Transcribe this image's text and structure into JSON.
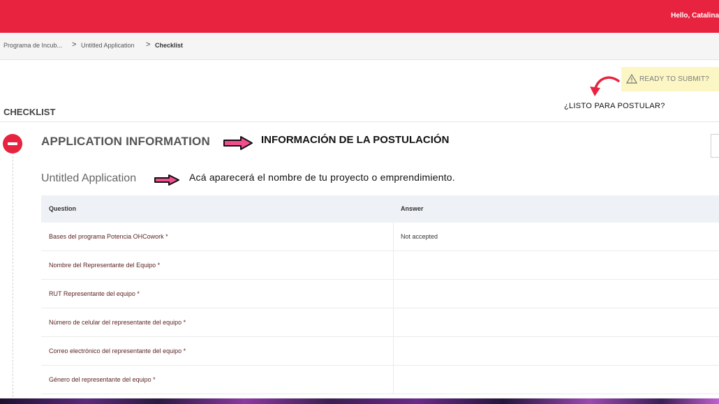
{
  "header": {
    "greeting": "Hello, Catalina"
  },
  "breadcrumb": {
    "items": [
      "Programa de Incub...",
      "Untitled Application",
      "Checklist"
    ],
    "separator": ">"
  },
  "status": {
    "ready_label": "READY TO SUBMIT?",
    "annotation": "¿LISTO PARA POSTULAR?"
  },
  "checklist": {
    "title": "CHECKLIST"
  },
  "section": {
    "title": "APPLICATION INFORMATION",
    "annotation": "INFORMACIÓN DE LA POSTULACIÓN",
    "application_name": "Untitled Application",
    "application_annotation": "Acá aparecerá el nombre de tu proyecto o emprendimiento."
  },
  "table": {
    "headers": [
      "Question",
      "Answer"
    ],
    "rows": [
      {
        "question": "Bases del programa Potencia OHCowork *",
        "answer": "Not accepted"
      },
      {
        "question": "Nombre del Representante del Equipo *",
        "answer": ""
      },
      {
        "question": "RUT Representante del equipo *",
        "answer": ""
      },
      {
        "question": "Número de celular del representante del equipo *",
        "answer": ""
      },
      {
        "question": "Correo electrónico del representante del equipo *",
        "answer": ""
      },
      {
        "question": "Género del representante del equipo *",
        "answer": ""
      }
    ]
  },
  "colors": {
    "brand_red": "#e8233f",
    "annotation_pink": "#f04e8c",
    "ready_bg": "#fbf6c4"
  },
  "icons": {
    "warning": "warning-triangle-icon",
    "collapse": "minus-circle-icon",
    "arrow": "arrow-right-icon"
  }
}
